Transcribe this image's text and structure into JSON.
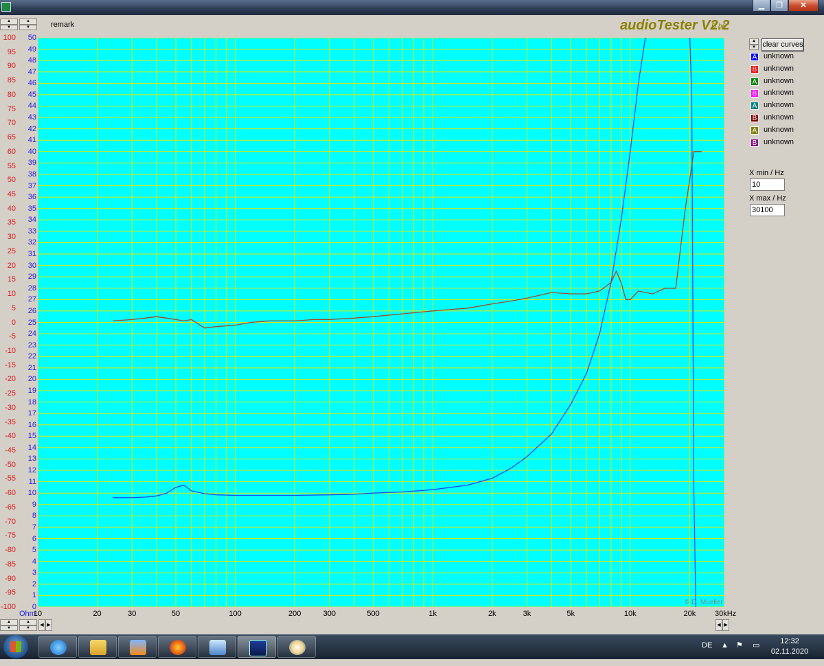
{
  "window": {
    "minimize_glyph": "▁",
    "restore_glyph": "❐",
    "close_glyph": "✕"
  },
  "header": {
    "remark": "remark",
    "brand": "audioTester  V2.2",
    "brand_sub": "D b6"
  },
  "y_scale_left": [
    "100",
    "95",
    "90",
    "85",
    "80",
    "75",
    "70",
    "65",
    "60",
    "55",
    "50",
    "45",
    "40",
    "35",
    "30",
    "25",
    "20",
    "15",
    "10",
    "5",
    "0",
    "-5",
    "-10",
    "-15",
    "-20",
    "-25",
    "-30",
    "-35",
    "-40",
    "-45",
    "-50",
    "-55",
    "-60",
    "-65",
    "-70",
    "-75",
    "-80",
    "-85",
    "-90",
    "-95",
    "-100"
  ],
  "y_scale_right": [
    "50",
    "49",
    "48",
    "47",
    "46",
    "45",
    "44",
    "43",
    "42",
    "41",
    "40",
    "39",
    "38",
    "37",
    "36",
    "35",
    "34",
    "33",
    "32",
    "31",
    "30",
    "29",
    "28",
    "27",
    "26",
    "25",
    "24",
    "23",
    "22",
    "21",
    "20",
    "19",
    "18",
    "17",
    "16",
    "15",
    "14",
    "13",
    "12",
    "11",
    "10",
    "9",
    "8",
    "7",
    "6",
    "5",
    "4",
    "3",
    "2",
    "1",
    "0"
  ],
  "x_labels": [
    "10",
    "20",
    "30",
    "50",
    "100",
    "200",
    "300",
    "500",
    "1k",
    "2k",
    "3k",
    "5k",
    "10k",
    "20k"
  ],
  "x_unit": "30kHz",
  "y_unit": "Ohm",
  "watermark": "© D. Mueller",
  "panel": {
    "clear_label": "clear curves",
    "legend": [
      {
        "letter": "A",
        "label": "unknown",
        "color": "#0000ff"
      },
      {
        "letter": "B",
        "label": "unknown",
        "color": "#ff0000"
      },
      {
        "letter": "A",
        "label": "unknown",
        "color": "#008000"
      },
      {
        "letter": "B",
        "label": "unknown",
        "color": "#ff00ff"
      },
      {
        "letter": "A",
        "label": "unknown",
        "color": "#008080"
      },
      {
        "letter": "B",
        "label": "unknown",
        "color": "#800000"
      },
      {
        "letter": "A",
        "label": "unknown",
        "color": "#808000"
      },
      {
        "letter": "B",
        "label": "unknown",
        "color": "#800080"
      }
    ],
    "xmin_label": "X min / Hz",
    "xmin_value": "10",
    "xmax_label": "X max / Hz",
    "xmax_value": "30100"
  },
  "taskbar": {
    "language": "DE",
    "time": "12:32",
    "date": "02.11.2020"
  },
  "colors": {
    "plot_bg": "#00ffff",
    "grid": "#e6e600",
    "impedance_curve": "#1a4cf0",
    "phase_curve": "#a04a28"
  },
  "chart_data": {
    "type": "line",
    "x_scale": "log",
    "xlim": [
      10,
      30000
    ],
    "y_left_range": [
      -100,
      100
    ],
    "y_left_unit": "",
    "y_right_range": [
      0,
      50
    ],
    "y_right_unit": "Ohm",
    "series": [
      {
        "axis": "right",
        "color": "#1a4cf0",
        "points": [
          [
            24,
            9.6
          ],
          [
            30,
            9.6
          ],
          [
            35,
            9.65
          ],
          [
            40,
            9.75
          ],
          [
            45,
            10
          ],
          [
            50,
            10.5
          ],
          [
            55,
            10.7
          ],
          [
            60,
            10.2
          ],
          [
            70,
            9.95
          ],
          [
            80,
            9.85
          ],
          [
            100,
            9.8
          ],
          [
            150,
            9.8
          ],
          [
            200,
            9.8
          ],
          [
            300,
            9.85
          ],
          [
            400,
            9.9
          ],
          [
            500,
            10
          ],
          [
            700,
            10.1
          ],
          [
            1000,
            10.3
          ],
          [
            1500,
            10.7
          ],
          [
            2000,
            11.3
          ],
          [
            2500,
            12.2
          ],
          [
            3000,
            13.2
          ],
          [
            4000,
            15.2
          ],
          [
            5000,
            17.8
          ],
          [
            6000,
            20.5
          ],
          [
            7000,
            24
          ],
          [
            8000,
            28.5
          ],
          [
            9000,
            34
          ],
          [
            10000,
            40
          ],
          [
            11000,
            46
          ],
          [
            12000,
            51
          ],
          [
            20000,
            51
          ],
          [
            20500,
            45
          ],
          [
            21000,
            10
          ],
          [
            21500,
            0
          ]
        ]
      },
      {
        "axis": "left",
        "color": "#a04a28",
        "points": [
          [
            24,
            0.5
          ],
          [
            30,
            1
          ],
          [
            35,
            1.5
          ],
          [
            40,
            2
          ],
          [
            45,
            1.5
          ],
          [
            50,
            1
          ],
          [
            55,
            0.5
          ],
          [
            60,
            1
          ],
          [
            70,
            -2
          ],
          [
            80,
            -1.5
          ],
          [
            100,
            -1
          ],
          [
            120,
            0
          ],
          [
            150,
            0.5
          ],
          [
            200,
            0.5
          ],
          [
            250,
            1
          ],
          [
            300,
            1
          ],
          [
            400,
            1.5
          ],
          [
            500,
            2
          ],
          [
            700,
            3
          ],
          [
            1000,
            4
          ],
          [
            1500,
            5
          ],
          [
            2000,
            6.5
          ],
          [
            2500,
            7.5
          ],
          [
            3000,
            8.5
          ],
          [
            4000,
            10.5
          ],
          [
            5000,
            10
          ],
          [
            6000,
            10
          ],
          [
            7000,
            11
          ],
          [
            8000,
            14
          ],
          [
            8500,
            18
          ],
          [
            9000,
            14
          ],
          [
            9500,
            8
          ],
          [
            10000,
            8
          ],
          [
            11000,
            11
          ],
          [
            13000,
            10
          ],
          [
            15000,
            12
          ],
          [
            17000,
            12
          ],
          [
            19000,
            40
          ],
          [
            20000,
            50
          ],
          [
            21000,
            60
          ],
          [
            23000,
            60
          ]
        ]
      }
    ]
  }
}
